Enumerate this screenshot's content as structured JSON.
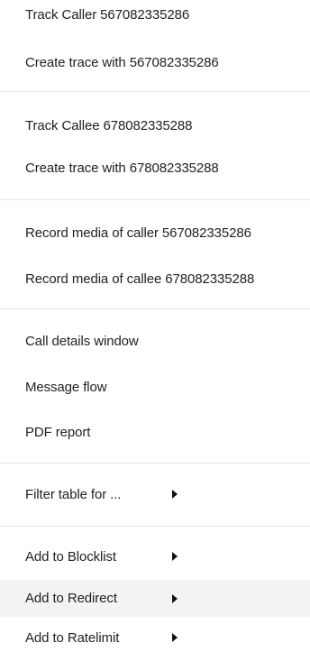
{
  "menu": {
    "groups": [
      {
        "items": [
          {
            "label": "Track Caller 567082335286"
          },
          {
            "label": "Create trace with 567082335286"
          }
        ]
      },
      {
        "items": [
          {
            "label": "Track Callee 678082335288"
          },
          {
            "label": "Create trace with 678082335288"
          }
        ]
      },
      {
        "items": [
          {
            "label": "Record media of caller 567082335286"
          },
          {
            "label": "Record media of callee 678082335288"
          }
        ]
      },
      {
        "items": [
          {
            "label": "Call details window"
          },
          {
            "label": "Message flow"
          },
          {
            "label": "PDF report"
          }
        ]
      },
      {
        "items": [
          {
            "label": "Filter table for ...",
            "submenu_icon": "chevron-right-icon"
          }
        ]
      },
      {
        "items": [
          {
            "label": "Add to Blocklist",
            "submenu_icon": "chevron-right-icon"
          },
          {
            "label": "Add to Redirect",
            "submenu_icon": "chevron-right-icon",
            "state": "hovered"
          },
          {
            "label": "Add to Ratelimit",
            "submenu_icon": "chevron-right-icon"
          }
        ]
      }
    ],
    "colors": {
      "background": "#ffffff",
      "text": "#222222",
      "separator": "#e6e6e6",
      "hover_background": "#f3f3f3"
    }
  }
}
